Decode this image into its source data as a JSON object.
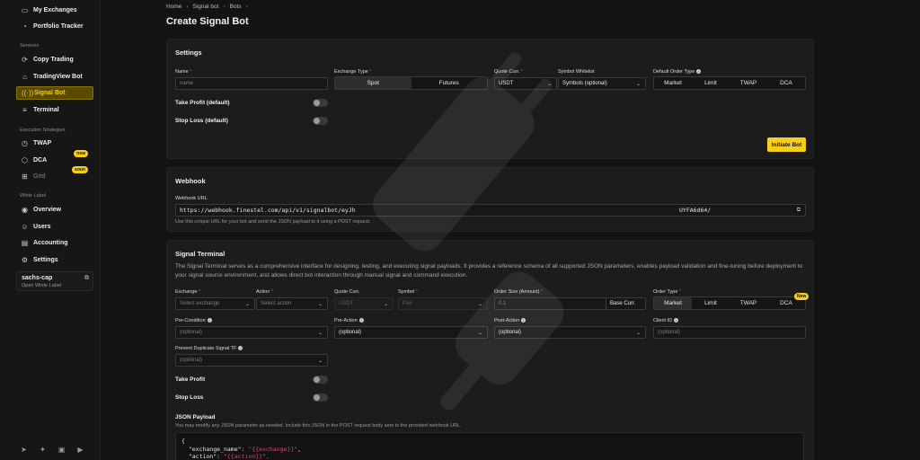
{
  "sidebar": {
    "top_items": [
      {
        "label": "My Exchanges",
        "icon": "wallet-icon"
      },
      {
        "label": "Portfolio Tracker",
        "icon": "chart-icon"
      }
    ],
    "services_label": "Services",
    "services": [
      {
        "label": "Copy Trading",
        "icon": "copy-icon"
      },
      {
        "label": "TradingView Bot",
        "icon": "bot-icon"
      },
      {
        "label": "Signal Bot",
        "icon": "signal-icon",
        "active": true
      },
      {
        "label": "Terminal",
        "icon": "terminal-icon"
      }
    ],
    "exec_label": "Execution Strategies",
    "exec": [
      {
        "label": "TWAP",
        "icon": "clock-icon"
      },
      {
        "label": "DCA",
        "icon": "dca-icon",
        "badge": "new"
      },
      {
        "label": "Grid",
        "icon": "grid-icon",
        "badge": "soon"
      }
    ],
    "wl_label": "White Label",
    "white_label": [
      {
        "label": "Overview",
        "icon": "overview-icon"
      },
      {
        "label": "Users",
        "icon": "users-icon"
      },
      {
        "label": "Accounting",
        "icon": "accounting-icon"
      },
      {
        "label": "Settings",
        "icon": "settings-icon"
      }
    ],
    "wl_card": {
      "name": "sachs-cap",
      "sub": "Open White Label"
    }
  },
  "breadcrumb": [
    "Home",
    "Signal bot",
    "Bots"
  ],
  "page_title": "Create Signal Bot",
  "settings": {
    "title": "Settings",
    "name_label": "Name",
    "name_placeholder": "name",
    "exchange_type_label": "Exchange Type",
    "exchange_types": [
      "Spot",
      "Futures"
    ],
    "quote_label": "Quote Curr.",
    "quote_value": "USDT",
    "whitelist_label": "Symbol Whitelist",
    "whitelist_value": "Symbols (optional)",
    "order_type_label": "Default Order Type",
    "order_types": [
      "Market",
      "Limit",
      "TWAP",
      "DCA"
    ],
    "tp_label": "Take Profit (default)",
    "sl_label": "Stop Loss (default)",
    "button": "Initiate Bot"
  },
  "webhook": {
    "title": "Webhook",
    "url_label": "Webhook URL",
    "url_start": "https://webhook.finestel.com/api/v1/signalbot/eyJh",
    "url_end": "UYFA6d64/",
    "hint": "Use this unique URL for your bot and send the JSON payload to it using a POST request."
  },
  "terminal": {
    "title": "Signal Terminal",
    "description": "The Signal Terminal serves as a comprehensive interface for designing, testing, and executing signal payloads. It provides a reference schema of all supported JSON parameters, enables payload validation and fine-tuning before deployment to your signal source environment, and allows direct bot interaction through manual signal and command execution.",
    "exchange_label": "Exchange",
    "exchange_placeholder": "Select exchange",
    "action_label": "Action",
    "action_placeholder": "Select action",
    "quote_label": "Quote Curr.",
    "quote_value": "USDT",
    "symbol_label": "Symbol",
    "symbol_value": "Pair",
    "order_size_label": "Order Size (Amount)",
    "order_size_value": "0.1",
    "base_curr": "Base Curr.",
    "order_type_label": "Order Type",
    "order_types": [
      "Market",
      "Limit",
      "TWAP",
      "DCA"
    ],
    "new_badge": "New",
    "precondition_label": "Pre-Condition",
    "preaction_label": "Pre-Action",
    "postaction_label": "Post-Action",
    "clientid_label": "Client ID",
    "optional": "(optional)",
    "prevent_label": "Prevent Duplicate Signal TF",
    "tp_label": "Take Profit",
    "sl_label": "Stop Loss",
    "json_title": "JSON Payload",
    "json_hint": "You may modify any JSON parameter as needed. Include this JSON in the POST request body sent to the provided webhook URL.",
    "json_line1": "{",
    "json_key2": "  \"exchange_name\": ",
    "json_val2": "\"{{exchange}}\"",
    "json_key3": "  \"action\": ",
    "json_val3": "\"{{action}}\","
  },
  "colors": {
    "accent": "#f5cf1a",
    "active_bg": "#5a4a00",
    "required": "#e24b4b"
  }
}
